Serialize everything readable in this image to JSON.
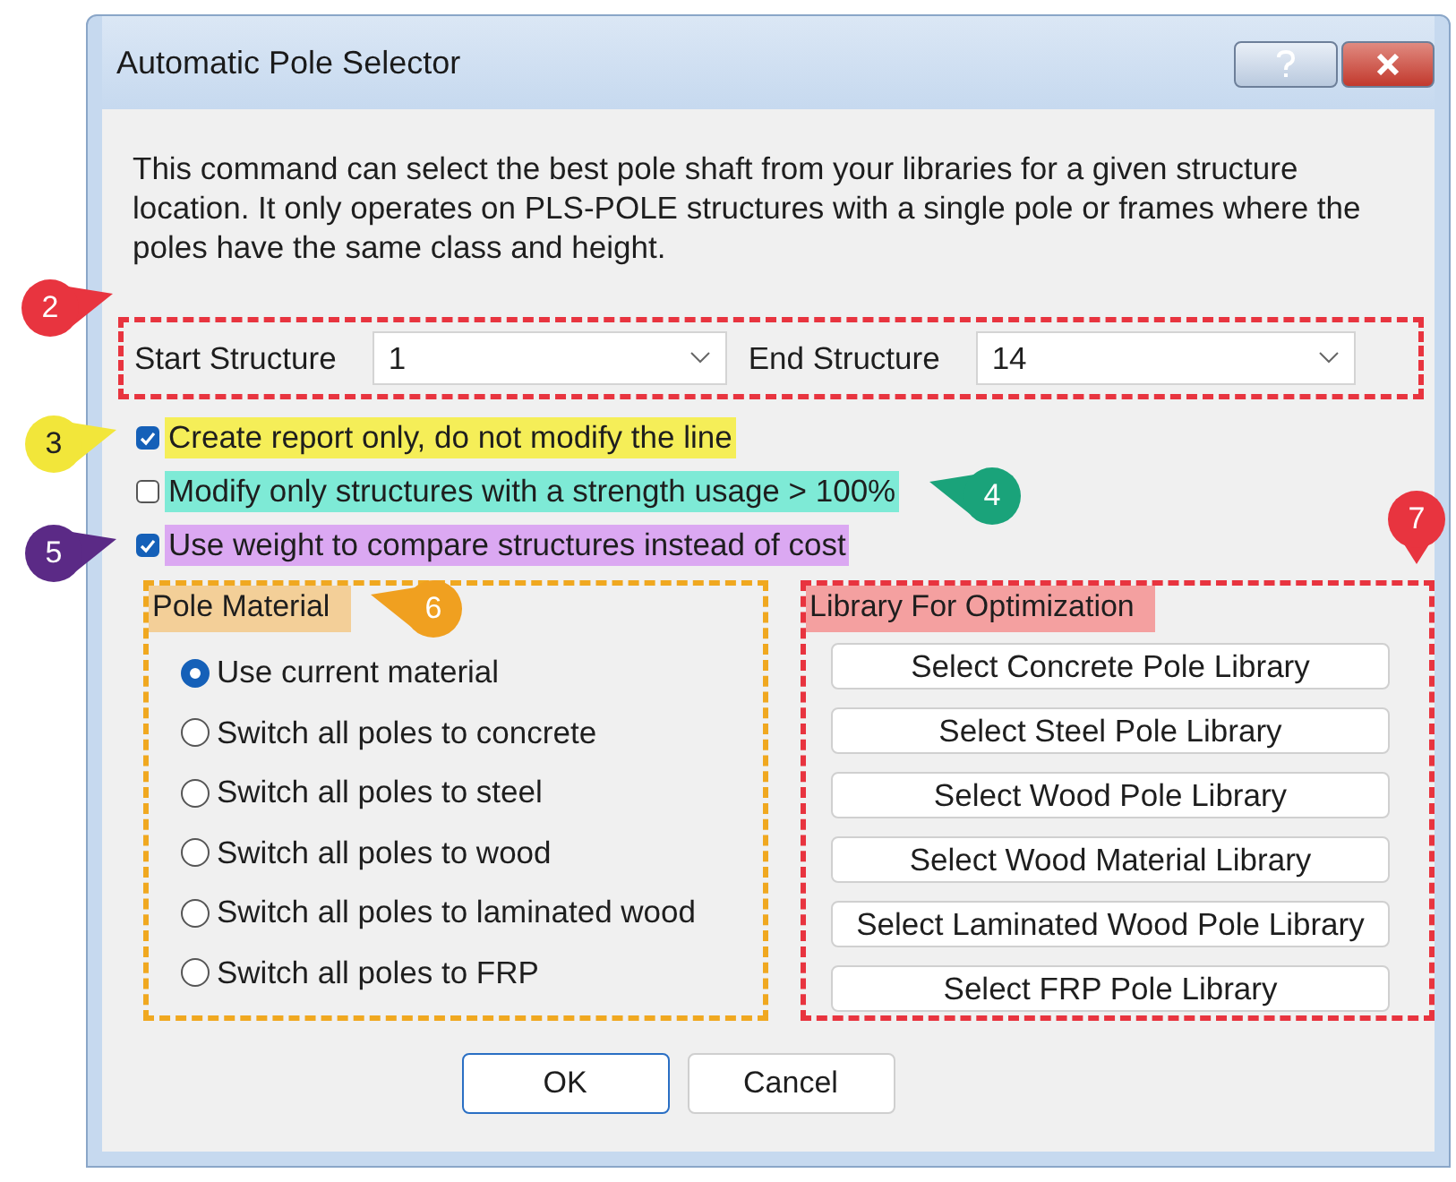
{
  "window": {
    "title": "Automatic Pole Selector"
  },
  "description": "This command can select the best pole shaft from your libraries for a given structure location.  It only operates on PLS-POLE structures with a single pole or frames where the poles have the same class and height.",
  "range": {
    "start_label": "Start Structure",
    "start_value": "1",
    "end_label": "End Structure",
    "end_value": "14"
  },
  "options": [
    {
      "label": "Create report only, do not modify the line",
      "checked": true,
      "color": "#f5ee58"
    },
    {
      "label": "Modify only structures with a strength usage > 100%",
      "checked": false,
      "color": "#7eead6"
    },
    {
      "label": "Use weight to compare structures instead of cost",
      "checked": true,
      "color": "#dba8f2"
    }
  ],
  "pole_material": {
    "title": "Pole Material",
    "choices": [
      {
        "label": "Use current material",
        "selected": true
      },
      {
        "label": "Switch all poles to concrete",
        "selected": false
      },
      {
        "label": "Switch all poles to steel",
        "selected": false
      },
      {
        "label": "Switch all poles to wood",
        "selected": false
      },
      {
        "label": "Switch all poles to laminated wood",
        "selected": false
      },
      {
        "label": "Switch all poles to FRP",
        "selected": false
      }
    ]
  },
  "library": {
    "title": "Library For Optimization",
    "buttons": [
      "Select Concrete Pole Library",
      "Select Steel Pole Library",
      "Select Wood Pole Library",
      "Select Wood Material Library",
      "Select Laminated Wood Pole Library",
      "Select FRP Pole Library"
    ]
  },
  "buttons": [
    "OK",
    "Cancel"
  ],
  "callouts": [
    {
      "number": "2",
      "color": "#e8343f"
    },
    {
      "number": "3",
      "color": "#f2e63a"
    },
    {
      "number": "4",
      "color": "#1aa37a"
    },
    {
      "number": "5",
      "color": "#5b2a86"
    },
    {
      "number": "6",
      "color": "#f0a020"
    },
    {
      "number": "7",
      "color": "#e8343f"
    }
  ]
}
